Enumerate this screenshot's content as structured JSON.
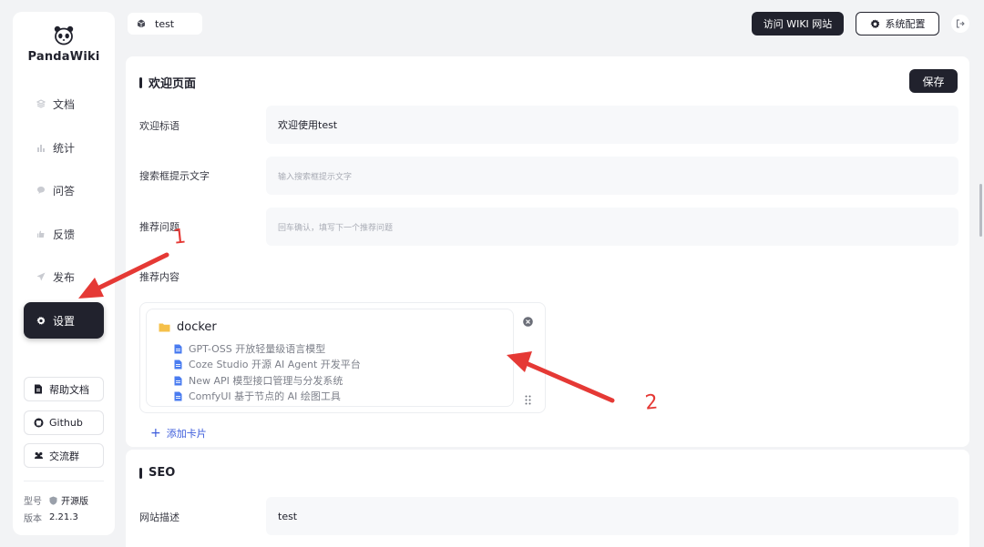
{
  "brand": {
    "name": "PandaWiki"
  },
  "sidebar": {
    "items": [
      {
        "label": "文档",
        "icon": "stack-icon"
      },
      {
        "label": "统计",
        "icon": "bar-chart-icon"
      },
      {
        "label": "问答",
        "icon": "chat-bubble-icon"
      },
      {
        "label": "反馈",
        "icon": "hand-icon"
      },
      {
        "label": "发布",
        "icon": "send-icon"
      },
      {
        "label": "设置",
        "icon": "gear-icon",
        "active": true
      }
    ],
    "links": [
      {
        "label": "帮助文档",
        "icon": "document-icon"
      },
      {
        "label": "Github",
        "icon": "github-icon"
      },
      {
        "label": "交流群",
        "icon": "group-icon"
      }
    ],
    "meta": {
      "model_label": "型号",
      "model_value": "开源版",
      "version_label": "版本",
      "version_value": "2.21.3"
    }
  },
  "topbar": {
    "kb_name": "test",
    "visit_wiki_label": "访问 WIKI 网站",
    "system_config_label": "系统配置"
  },
  "welcome": {
    "title": "欢迎页面",
    "save_label": "保存",
    "welcome_label": "欢迎标语",
    "welcome_value": "欢迎使用test",
    "search_hint_label": "搜索框提示文字",
    "search_hint_placeholder": "输入搜索框提示文字",
    "recommend_q_label": "推荐问题",
    "recommend_q_placeholder": "回车确认，填写下一个推荐问题",
    "recommend_content_label": "推荐内容",
    "card": {
      "folder": "docker",
      "docs": [
        "GPT-OSS 开放轻量级语言模型",
        "Coze Studio 开源 AI Agent 开发平台",
        "New API 模型接口管理与分发系统",
        "ComfyUI 基于节点的 AI 绘图工具"
      ]
    },
    "add_card_label": "添加卡片"
  },
  "seo": {
    "title": "SEO",
    "desc_label": "网站描述",
    "desc_value": "test"
  },
  "annotations": {
    "one": "1",
    "two": "2"
  },
  "colors": {
    "dark": "#21222d",
    "accent": "#3b5bdb",
    "annotation": "#e53935",
    "folder": "#f5c04a",
    "doc": "#4a7cf0"
  }
}
